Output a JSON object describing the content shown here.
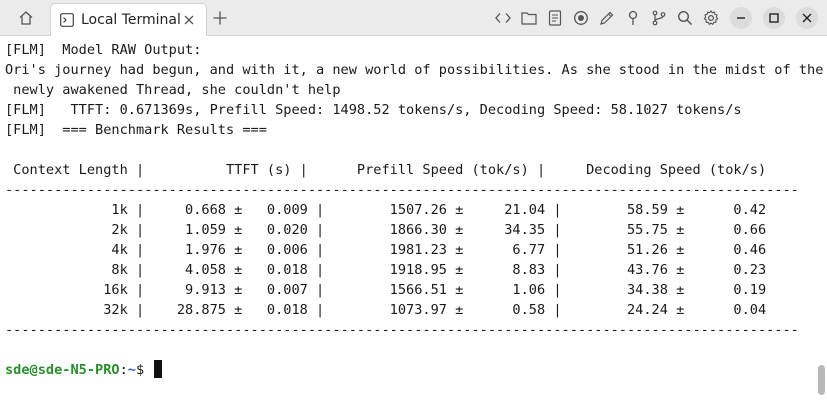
{
  "tab": {
    "title": "Local Terminal"
  },
  "toolbar_icons": [
    "code-icon",
    "folder-icon",
    "notes-icon",
    "record-icon",
    "pen-icon",
    "pin-icon",
    "branch-icon",
    "search-icon",
    "gear-icon"
  ],
  "terminal": {
    "lines": [
      "[FLM]  Model RAW Output:",
      "Ori's journey had begun, and with it, a new world of possibilities. As she stood in the midst of the",
      " newly awakened Thread, she couldn't help",
      "[FLM]   TTFT: 0.671369s, Prefill Speed: 1498.52 tokens/s, Decoding Speed: 58.1027 tokens/s",
      "[FLM]  === Benchmark Results ===",
      "",
      " Context Length |          TTFT (s) |      Prefill Speed (tok/s) |     Decoding Speed (tok/s)",
      "-------------------------------------------------------------------------------------------------",
      "             1k |     0.668 ±   0.009 |        1507.26 ±     21.04 |        58.59 ±      0.42",
      "             2k |     1.059 ±   0.020 |        1866.30 ±     34.35 |        55.75 ±      0.66",
      "             4k |     1.976 ±   0.006 |        1981.23 ±      6.77 |        51.26 ±      0.46",
      "             8k |     4.058 ±   0.018 |        1918.95 ±      8.83 |        43.76 ±      0.23",
      "            16k |     9.913 ±   0.007 |        1566.51 ±      1.06 |        34.38 ±      0.19",
      "            32k |    28.875 ±   0.018 |        1073.97 ±      0.58 |        24.24 ±      0.04",
      "-------------------------------------------------------------------------------------------------",
      ""
    ],
    "prompt": {
      "user_host": "sde@sde-N5-PRO",
      "sep": ":",
      "path": "~",
      "symbol": "$ "
    }
  }
}
